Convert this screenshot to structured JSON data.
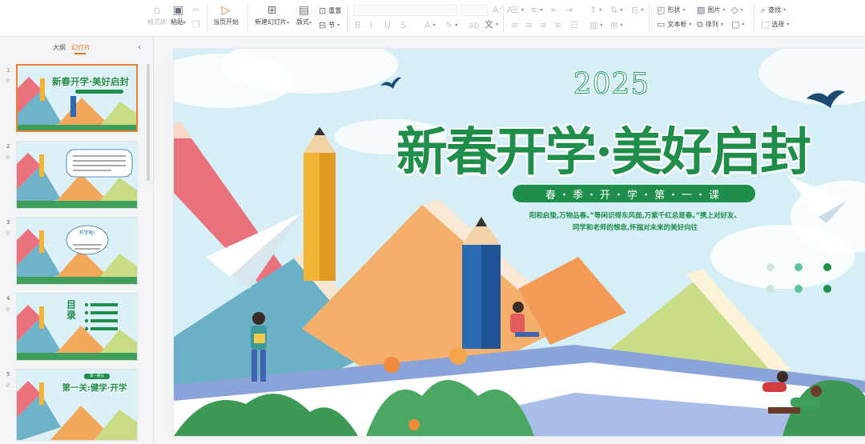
{
  "ribbon": {
    "format_painter": "格式刷",
    "paste": "粘贴",
    "play_from_current": "当页开始",
    "new_slide": "新建幻灯片",
    "layout": "版式",
    "reset": "重置",
    "section": "节",
    "shape": "形状",
    "picture": "图片",
    "textbox": "文本框",
    "arrange": "排列",
    "find": "查找",
    "select": "选择"
  },
  "panel": {
    "tab_outline": "大纲",
    "tab_slides": "幻灯片",
    "slide_numbers": [
      "1",
      "2",
      "3",
      "4",
      "5"
    ]
  },
  "thumbnails": {
    "t1_title": "新春开学·美好启封",
    "t3_title": "开学啦!",
    "t4_title": "目录",
    "t5_badge": "第一部分",
    "t5_title": "第一关:健学·开学"
  },
  "slide": {
    "year": "2025",
    "title": "新春开学·美好启封",
    "subtitle": "春・季・开・学・第・一・课",
    "body_line1": "阳和启蛰,万物品春。”等闲识得东风面,万紫千红总是春。”携上对好友、",
    "body_line2": "同学和老师的想念,怀揣对未来的美好向往"
  },
  "colors": {
    "accent_orange": "#e2731e",
    "title_green": "#1e8e4a"
  }
}
